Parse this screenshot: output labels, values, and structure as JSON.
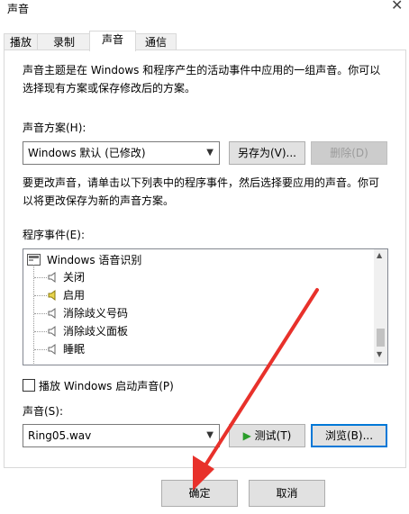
{
  "window": {
    "title": "声音",
    "close_glyph": "✕"
  },
  "tabs": [
    {
      "label": "播放"
    },
    {
      "label": "录制"
    },
    {
      "label": "声音",
      "active": true
    },
    {
      "label": "通信"
    }
  ],
  "intro_text_line1": "声音主题是在 Windows 和程序产生的活动事件中应用的一组声音。你可以",
  "intro_text_line2": "选择现有方案或保存修改后的方案。",
  "scheme": {
    "label": "声音方案(H):",
    "value": "Windows 默认 (已修改)",
    "save_as_label": "另存为(V)...",
    "delete_label": "删除(D)"
  },
  "change_text_line1": "要更改声音，请单击以下列表中的程序事件，然后选择要应用的声音。你可",
  "change_text_line2": "以将更改保存为新的声音方案。",
  "events": {
    "label": "程序事件(E):",
    "group": "Windows 语音识别",
    "items": [
      {
        "label": "关闭",
        "has_sound": false
      },
      {
        "label": "启用",
        "has_sound": true
      },
      {
        "label": "消除歧义号码",
        "has_sound": false
      },
      {
        "label": "消除歧义面板",
        "has_sound": false
      },
      {
        "label": "睡眠",
        "has_sound": false
      }
    ]
  },
  "startup_sound": {
    "label": "播放 Windows 启动声音(P)",
    "checked": false
  },
  "sound": {
    "label": "声音(S):",
    "value": "Ring05.wav",
    "test_label": "测试(T)",
    "browse_label": "浏览(B)..."
  },
  "footer": {
    "ok_label": "确定",
    "cancel_label": "取消"
  },
  "colors": {
    "accent": "#0078d7",
    "annotation_arrow": "#e8312b",
    "speaker_active": "#e8d44d"
  }
}
